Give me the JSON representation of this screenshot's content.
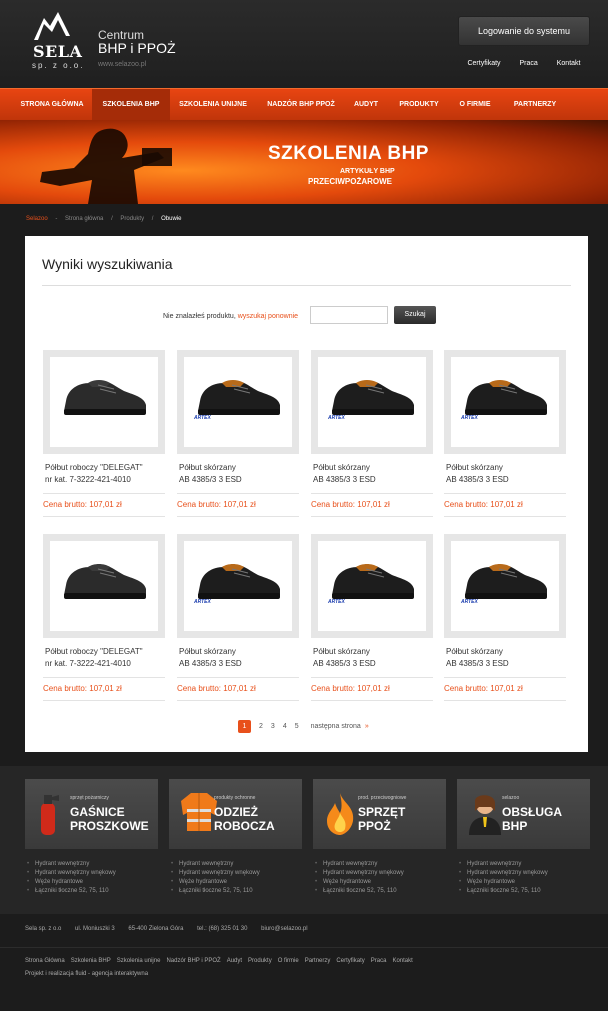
{
  "header": {
    "logo_name": "SELA",
    "logo_sub": "sp. z o.o.",
    "site_line1": "Centrum",
    "site_line2": "BHP i PPOŻ",
    "site_url": "www.selazoo.pl",
    "login_label": "Logowanie do systemu",
    "top_links": [
      "Certyfikaty",
      "Praca",
      "Kontakt"
    ]
  },
  "nav": {
    "items": [
      "STRONA GŁÓWNA",
      "SZKOLENIA BHP",
      "SZKOLENIA UNIJNE",
      "NADZÓR BHP PPOŻ",
      "AUDYT",
      "PRODUKTY",
      "O FIRMIE",
      "PARTNERZY"
    ],
    "active_index": 1
  },
  "banner": {
    "title": "SZKOLENIA BHP",
    "subtitle1": "ARTYKUŁY BHP",
    "subtitle2": "PRZECIWPOŻAROWE"
  },
  "breadcrumb": [
    "Selazoo",
    "Strona główna",
    "Produkty",
    "Obuwie"
  ],
  "breadcrumb_sep": "/",
  "main": {
    "title": "Wyniki wyszukiwania",
    "search_msg_prefix": "Nie znalazłeś produktu,",
    "search_msg_link": "wyszukaj ponownie",
    "search_placeholder": "",
    "search_button": "Szukaj"
  },
  "products": [
    {
      "name1": "Półbut roboczy \"DELEGAT\"",
      "name2": "nr kat. 7-3222-421-4010",
      "price": "Cena brutto: 107,01 zł",
      "brand": "",
      "style": "black"
    },
    {
      "name1": "Półbut skórzany",
      "name2": "AB 4385/3 3 ESD",
      "price": "Cena brutto: 107,01 zł",
      "brand": "ARTEX",
      "style": "brown"
    },
    {
      "name1": "Półbut skórzany",
      "name2": "AB 4385/3 3 ESD",
      "price": "Cena brutto: 107,01 zł",
      "brand": "ARTEX",
      "style": "brown"
    },
    {
      "name1": "Półbut skórzany",
      "name2": "AB 4385/3 3 ESD",
      "price": "Cena brutto: 107,01 zł",
      "brand": "ARTEX",
      "style": "brown"
    },
    {
      "name1": "Półbut roboczy \"DELEGAT\"",
      "name2": "nr kat. 7-3222-421-4010",
      "price": "Cena brutto: 107,01 zł",
      "brand": "",
      "style": "black"
    },
    {
      "name1": "Półbut skórzany",
      "name2": "AB 4385/3 3 ESD",
      "price": "Cena brutto: 107,01 zł",
      "brand": "ARTEX",
      "style": "brown"
    },
    {
      "name1": "Półbut skórzany",
      "name2": "AB 4385/3 3 ESD",
      "price": "Cena brutto: 107,01 zł",
      "brand": "ARTEX",
      "style": "brown"
    },
    {
      "name1": "Półbut skórzany",
      "name2": "AB 4385/3 3 ESD",
      "price": "Cena brutto: 107,01 zł",
      "brand": "ARTEX",
      "style": "brown"
    }
  ],
  "pagination": {
    "pages": [
      "1",
      "2",
      "3",
      "4",
      "5"
    ],
    "current": "1",
    "next_label": "następna strona",
    "next_arrow": "»"
  },
  "promos": [
    {
      "kicker": "sprzęt pożarniczy",
      "big1": "GAŚNICE",
      "big2": "PROSZKOWE",
      "icon": "extinguisher-icon",
      "list": [
        "Hydrant wewnętrzny",
        "Hydrant wewnętrzny wnękowy",
        "Węże hydrantowe",
        "Łączniki tłoczne 52, 75, 110"
      ]
    },
    {
      "kicker": "produkty ochronne",
      "big1": "ODZIEŻ",
      "big2": "ROBOCZA",
      "icon": "jacket-icon",
      "list": [
        "Hydrant wewnętrzny",
        "Hydrant wewnętrzny wnękowy",
        "Węże hydrantowe",
        "Łączniki tłoczne 52, 75, 110"
      ]
    },
    {
      "kicker": "prod. przeciwogniowe",
      "big1": "SPRZĘT",
      "big2": "PPOŻ",
      "icon": "flame-icon",
      "list": [
        "Hydrant wewnętrzny",
        "Hydrant wewnętrzny wnękowy",
        "Węże hydrantowe",
        "Łączniki tłoczne 52, 75, 110"
      ]
    },
    {
      "kicker": "selazoo",
      "big1": "OBSŁUGA",
      "big2": "BHP",
      "icon": "consultant-icon",
      "list": [
        "Hydrant wewnętrzny",
        "Hydrant wewnętrzny wnękowy",
        "Węże hydrantowe",
        "Łączniki tłoczne 52, 75, 110"
      ]
    }
  ],
  "footer": {
    "address": [
      "Sela sp. z o.o",
      "ul. Moniuszki 3",
      "65-400 Zielona Góra",
      "tel.: (68) 325 01 30",
      "biuro@selazoo.pl"
    ],
    "links": [
      "Strona Główna",
      "Szkolenia BHP",
      "Szkolenia unijne",
      "Nadzór BHP i PPOŻ",
      "Audyt",
      "Produkty",
      "O firmie",
      "Partnerzy",
      "Certyfikaty",
      "Praca",
      "Kontakt"
    ],
    "credit": "Projekt i realizacja fluid - agencja interaktywna"
  },
  "colors": {
    "accent": "#e8501b",
    "nav_bg": "#d63e10",
    "dark_bg": "#1c1c1c"
  }
}
